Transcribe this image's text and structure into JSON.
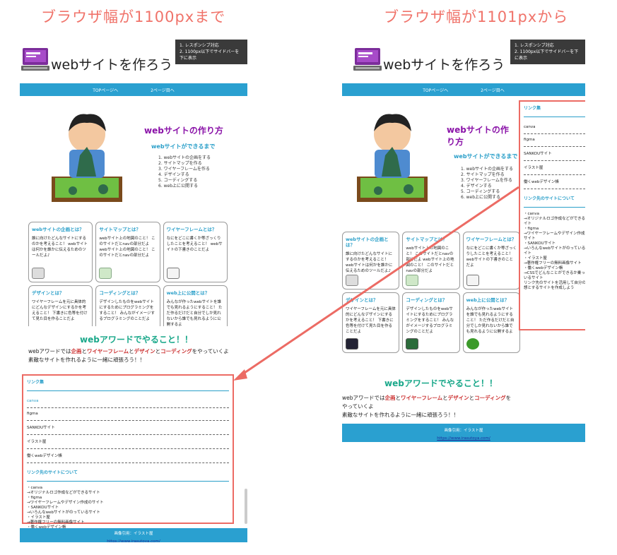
{
  "left_title": "ブラウザ幅が1100pxまで",
  "right_title": "ブラウザ幅が1101pxから",
  "notes": [
    "1. レスポンシブ対応",
    "2. 1100px以下でサイドバーを下に表示"
  ],
  "site_title": "webサイトを作ろう",
  "nav": [
    "TOPページへ",
    "2ページ目へ"
  ],
  "hero": {
    "title": "webサイトの作り方",
    "subtitle": "webサイトができるまで",
    "steps": [
      "1. webサイトの企画をする",
      "2. サイトマップを作る",
      "3. ワイヤーフレームを作る",
      "4. デザインする",
      "5. コーディングする",
      "6. web上に公開する"
    ]
  },
  "cards": [
    {
      "title": "webサイトの企画とは？",
      "body": "誰に向けたどんなサイトにするのかを考えること！ webサイトは何かを誰かに伝えるためのツールだよ♪"
    },
    {
      "title": "サイトマップとは？",
      "body": "webサイト上の地図のこと！ このサイトだとnavの部分だよ webサイト上の地図のこと！ このサイトだとnavの部分だよ"
    },
    {
      "title": "ワイヤーフレームとは？",
      "body": "なにをどこに書くか等ざっくりしたことを考えること！ webサイトの下書きのことだよ"
    },
    {
      "title": "デザインとは？",
      "body": "ワイヤーフレームを元に具体的にどんなデザインにするかを考えること！ 下書きに色等を付けて見た目を作ることだよ"
    },
    {
      "title": "コーディングとは？",
      "body": "デザインしたものをwebサイトにするためにプログラミングをすること！ みんながイメージするプログラミングのことだよ"
    },
    {
      "title": "web上に公開とは？",
      "body": "みんなが作ったwebサイトを誰でも見れるようにすること！ ただ作るだけだと自分でしか見れないから誰でも見れるように公開するよ"
    }
  ],
  "section_title": "webアワードでやること！！",
  "intro": {
    "p1a": "webアワードでは",
    "k1": "企画",
    "k2": "ワイヤーフレーム",
    "k3": "デザイン",
    "k4": "コーディング",
    "p1b": "をやっていくよ",
    "p2": "素敵なサイトを作れるように一緒に頑張ろう！！"
  },
  "sidebar": {
    "links_title": "リンク集",
    "links": [
      "canva",
      "figma",
      "SANKOUサイト",
      "イラスト屋",
      "働くwebデザイン帳"
    ],
    "ref_title": "リンク先のサイトについて",
    "refs": [
      "・canva",
      "→オリジナルロゴ作成などができるサイト",
      "・figma",
      "→ワイヤーフレームやデザイン作成のサイト",
      "・SANKOUサイト",
      "→いろんなwebサイトがのっているサイト",
      "・イラスト屋",
      "→著作権フリーの無料画像サイト",
      "・働くwebデザイン帳",
      "→CSSでどんなことができるか乗っているサイト",
      "リンク先のサイトを活用して自分の理想とするサイトを作成しよう"
    ]
  },
  "footer": {
    "credit": "画像引用：イラスト屋",
    "url": "https://www.irasutoya.com/"
  },
  "colors": {
    "accent": "#2aa0d0",
    "title": "#f0736a",
    "highlight": "#ec6b64"
  }
}
